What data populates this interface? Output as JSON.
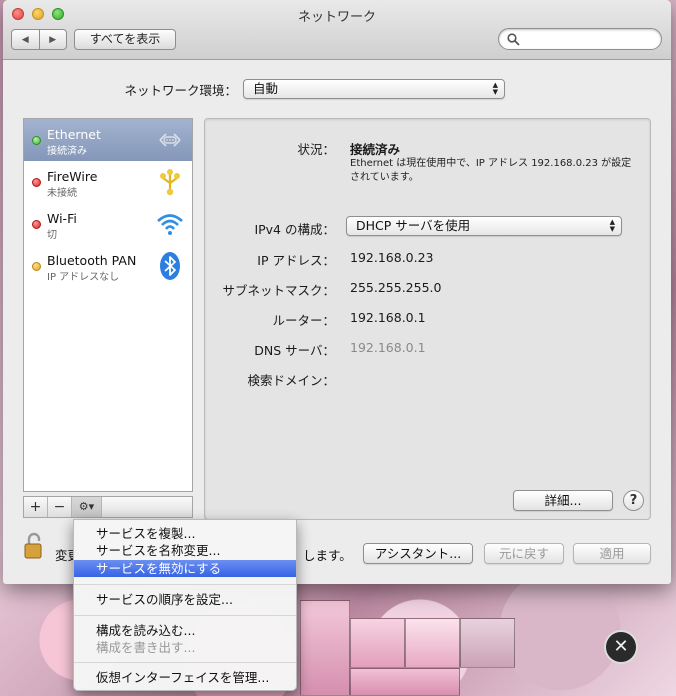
{
  "window": {
    "title": "ネットワーク",
    "show_all_label": "すべてを表示",
    "search_placeholder": ""
  },
  "location": {
    "label": "ネットワーク環境：",
    "value": "自動"
  },
  "services": [
    {
      "name": "Ethernet",
      "status": "接続済み",
      "status_color": "#3fb63a",
      "icon": "ethernet-icon",
      "selected": true
    },
    {
      "name": "FireWire",
      "status": "未接続",
      "status_color": "#d8262a",
      "icon": "firewire-icon",
      "selected": false
    },
    {
      "name": "Wi-Fi",
      "status": "切",
      "status_color": "#d8262a",
      "icon": "wifi-icon",
      "selected": false
    },
    {
      "name": "Bluetooth PAN",
      "status": "IP アドレスなし",
      "status_color": "#e3a81f",
      "icon": "bluetooth-icon",
      "selected": false
    }
  ],
  "toolbar": {
    "add": "+",
    "remove": "−",
    "gear": "⚙▾"
  },
  "detail": {
    "status_label": "状況：",
    "status_value": "接続済み",
    "status_description": "Ethernet は現在使用中で、IP アドレス 192.168.0.23 が設定されています。",
    "ipv4_label": "IPv4 の構成：",
    "ipv4_value": "DHCP サーバを使用",
    "ip_label": "IP アドレス：",
    "ip_value": "192.168.0.23",
    "subnet_label": "サブネットマスク：",
    "subnet_value": "255.255.255.0",
    "router_label": "ルーター：",
    "router_value": "192.168.0.1",
    "dns_label": "DNS サーバ：",
    "dns_value": "192.168.0.1",
    "search_domain_label": "検索ドメイン：",
    "advanced_button": "詳細...",
    "help_button": "?"
  },
  "footer": {
    "lock_text_start": "変更",
    "lock_text_end": "します。",
    "assistant_button": "アシスタント...",
    "revert_button": "元に戻す",
    "apply_button": "適用"
  },
  "context_menu": {
    "items": [
      {
        "label": "サービスを複製...",
        "state": "normal"
      },
      {
        "label": "サービスを名称変更...",
        "state": "normal"
      },
      {
        "label": "サービスを無効にする",
        "state": "highlighted"
      },
      {
        "label": "サービスの順序を設定...",
        "state": "normal"
      },
      {
        "label": "構成を読み込む...",
        "state": "normal"
      },
      {
        "label": "構成を書き出す...",
        "state": "disabled"
      },
      {
        "label": "仮想インターフェイスを管理...",
        "state": "normal"
      }
    ]
  },
  "colors": {
    "selection": "#8497b9",
    "menu_highlight": "#3763e6"
  }
}
